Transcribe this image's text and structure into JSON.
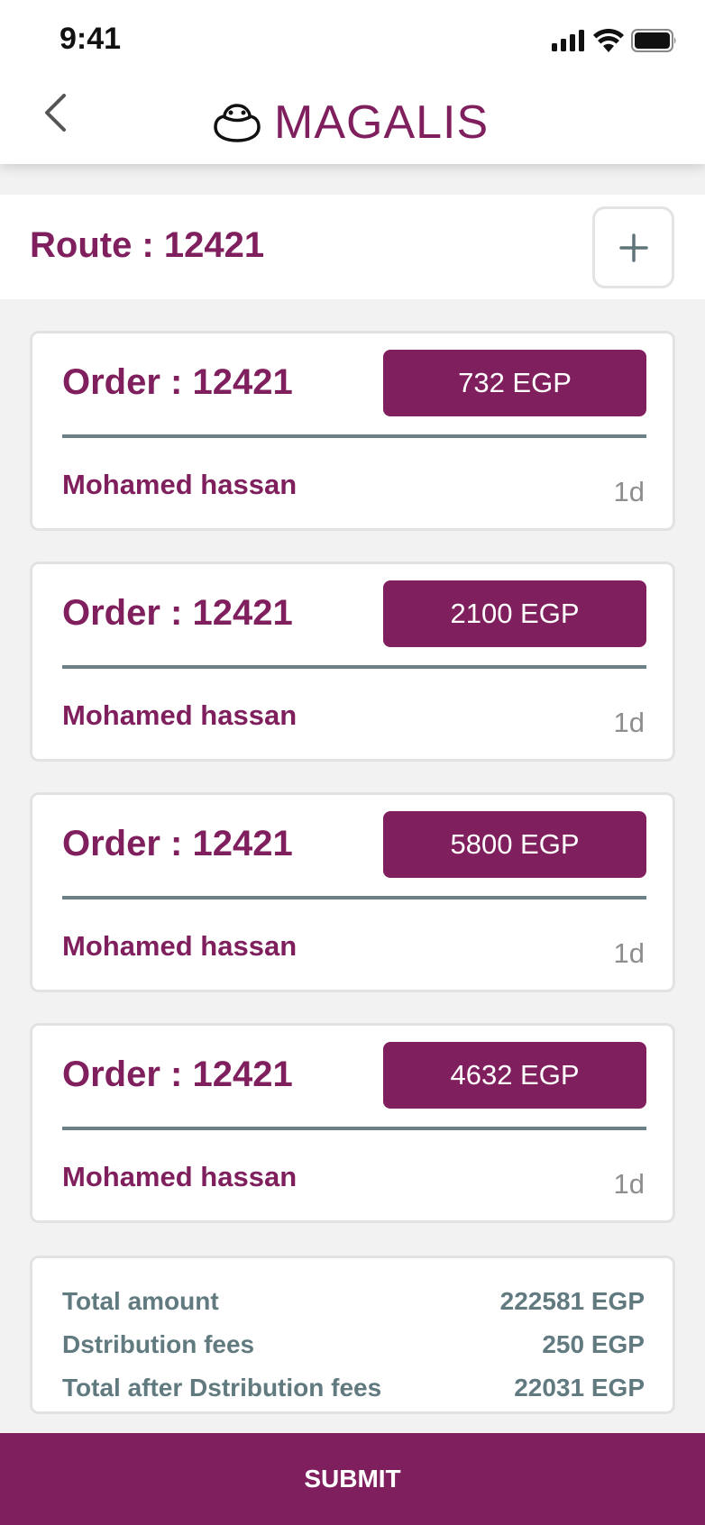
{
  "status_bar": {
    "time": "9:41"
  },
  "header": {
    "brand": "MAGALIS"
  },
  "route": {
    "title": "Route : 12421"
  },
  "orders": [
    {
      "title": "Order : 12421",
      "price": "732 EGP",
      "customer": "Mohamed hassan",
      "age": "1d"
    },
    {
      "title": "Order : 12421",
      "price": "2100 EGP",
      "customer": "Mohamed hassan",
      "age": "1d"
    },
    {
      "title": "Order : 12421",
      "price": "5800 EGP",
      "customer": "Mohamed hassan",
      "age": "1d"
    },
    {
      "title": "Order : 12421",
      "price": "4632 EGP",
      "customer": "Mohamed hassan",
      "age": "1d"
    }
  ],
  "summary": {
    "total_label": "Total amount",
    "total_value": "222581 EGP",
    "fees_label": "Dstribution fees",
    "fees_value": "250 EGP",
    "after_label": "Total after Dstribution fees",
    "after_value": "22031 EGP"
  },
  "submit_label": "SUBMIT",
  "colors": {
    "brand": "#801f5d",
    "divider": "#6b8084",
    "muted_text": "#607a7f"
  },
  "icons": [
    "signal-icon",
    "wifi-icon",
    "battery-icon",
    "back-arrow-icon",
    "logo-mark-icon",
    "plus-icon"
  ]
}
